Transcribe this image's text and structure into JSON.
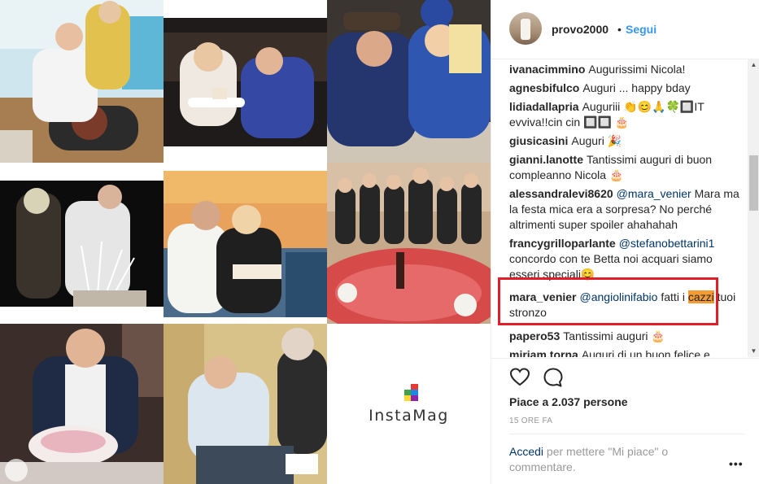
{
  "collage": {
    "brand_name": "InstaMag",
    "brand_logo_colors": [
      "#e53935",
      "#43a047",
      "#1e88e5",
      "#fdd835"
    ]
  },
  "post": {
    "username": "provo2000",
    "separator": "•",
    "follow_label": "Segui",
    "comments": [
      {
        "user": "ivanacimmino",
        "text": "Augurissimi Nicola!"
      },
      {
        "user": "agnesbifulco",
        "text": "Auguri ... happy bday"
      },
      {
        "user": "lidiadallapria",
        "text": "Auguriii 👏😊🙏🍀🔲IT evviva!!cin cin 🔲🔲 🎂"
      },
      {
        "user": "giusicasini",
        "text": "Auguri 🎉"
      },
      {
        "user": "gianni.lanotte",
        "text": "Tantissimi auguri di buon compleanno Nicola 🎂"
      },
      {
        "user": "alessandralevi8620",
        "mention": "@mara_venier",
        "text": "Mara ma la festa mica era a sorpresa? No perché altrimenti super spoiler ahahahah"
      },
      {
        "user": "francygrilloparlante",
        "mention": "@stefanobettarini1",
        "text": "concordo con te Betta noi acquari siamo esseri speciali😊"
      },
      {
        "user": "mara_venier",
        "mention": "@angiolinifabio",
        "text_before": "fatti i",
        "highlighted": "cazzi",
        "text_after": "tuoi stronzo"
      },
      {
        "user": "papero53",
        "text": "Tantissimi auguri 🎂"
      },
      {
        "user": "miriam.torna",
        "text": "Auguri di un buon felice e"
      }
    ],
    "likes": "Piace a 2.037 persone",
    "time": "15 ORE FA",
    "login_link": "Accedi",
    "login_text": "per mettere \"Mi piace\" o commentare.",
    "more": "•••"
  },
  "icons": {
    "like": "heart-icon",
    "comment": "comment-icon",
    "scroll_up": "▲",
    "scroll_down": "▼"
  },
  "colors": {
    "link_blue": "#3897f0",
    "mention_blue": "#003569",
    "highlight_orange": "#f59b36",
    "annotation_red": "#e11d2a"
  }
}
